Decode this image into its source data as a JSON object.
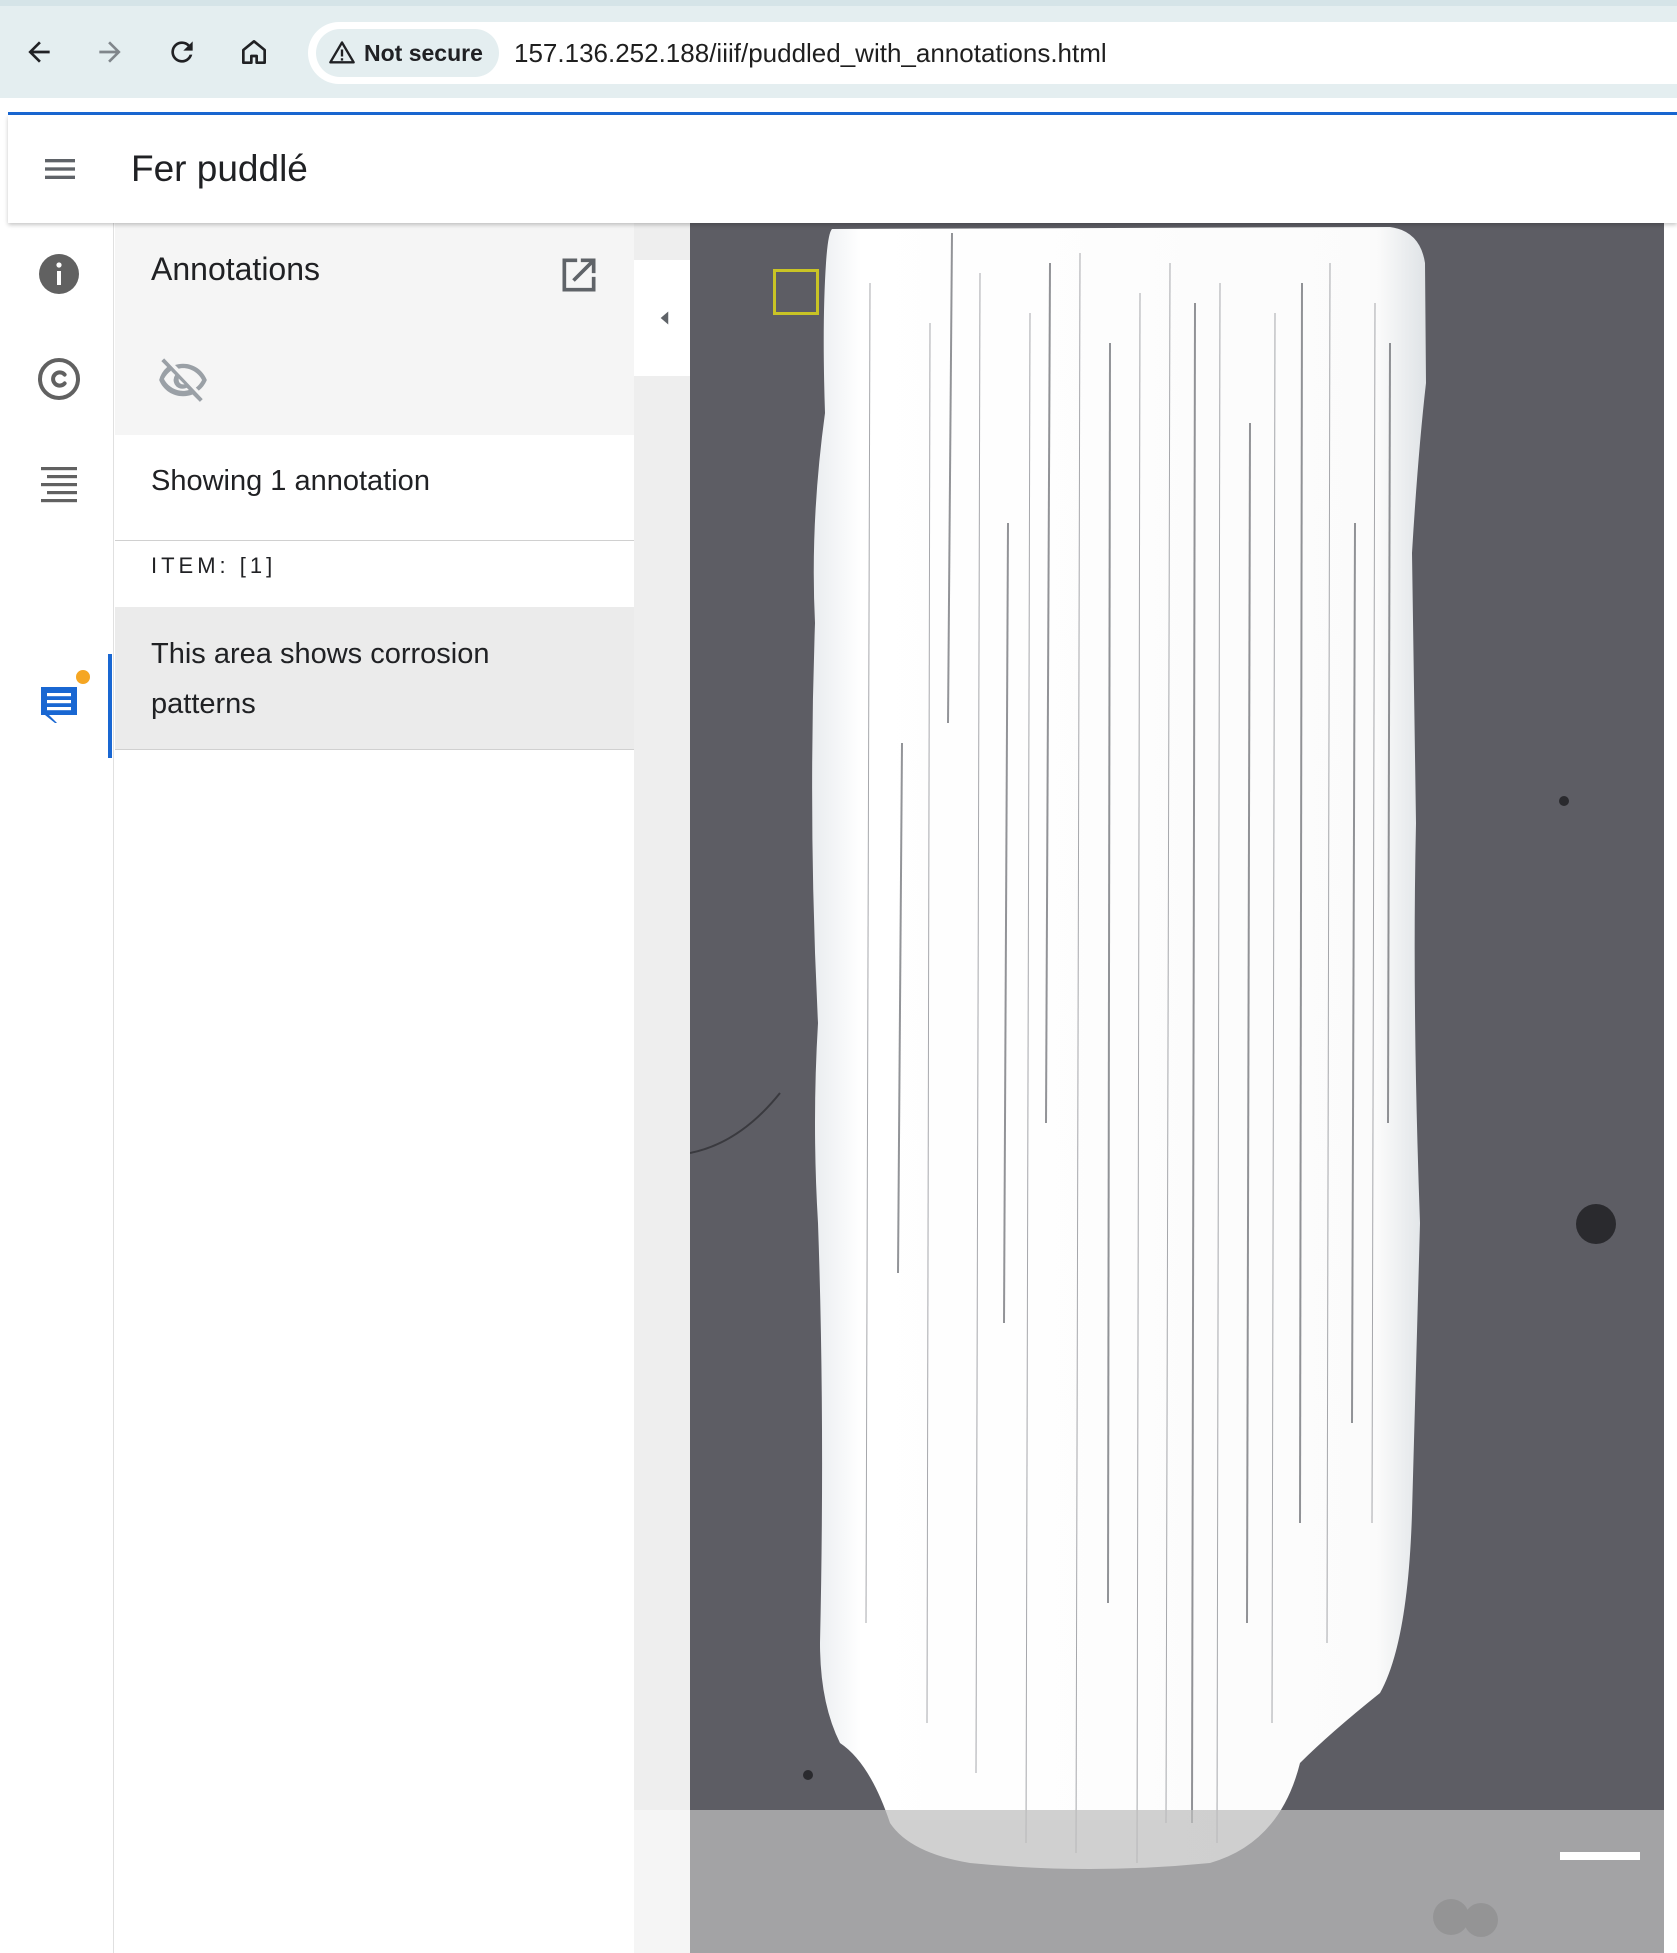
{
  "browser": {
    "security_label": "Not secure",
    "url": "157.136.252.188/iiif/puddled_with_annotations.html"
  },
  "app": {
    "title": "Fer puddlé"
  },
  "panel": {
    "title": "Annotations",
    "showing_label": "Showing 1 annotation",
    "item_label": "ITEM: [1]",
    "annotations": [
      {
        "text": "This area shows corrosion patterns"
      }
    ]
  },
  "rail": {
    "icons": [
      "info-icon",
      "copyright-icon",
      "list-icon",
      "annotations-icon"
    ],
    "active": "annotations-icon",
    "badge_color": "#f5a623"
  },
  "colors": {
    "accent": "#1967d2",
    "annotation_outline": "#c9c425",
    "viewer_background": "#5c5c63"
  }
}
